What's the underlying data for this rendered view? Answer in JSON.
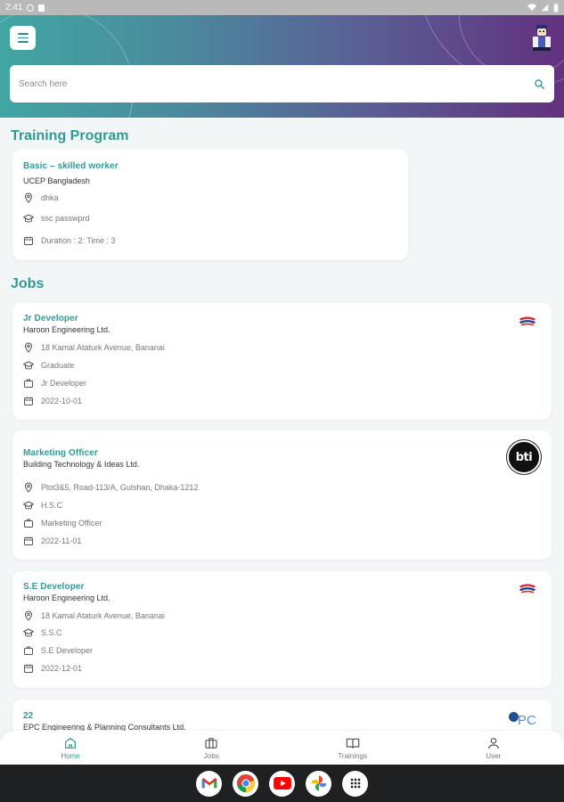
{
  "status_bar": {
    "time": "2:41"
  },
  "header": {
    "search_placeholder": "Search here"
  },
  "training_section": {
    "title": "Training Program",
    "cards": [
      {
        "title": "Basic – skilled worker",
        "organization": "UCEP Bangladesh",
        "location": "dhka",
        "qualification": "ssc passwprd",
        "duration": "Duration : 2: Time : 3"
      }
    ]
  },
  "jobs_section": {
    "title": "Jobs",
    "cards": [
      {
        "title": "Jr Developer",
        "company": "Haroon Engineering Ltd.",
        "address": "18 Kamal Ataturk Avenue, Bananai",
        "education": "Graduate",
        "position": "Jr Developer",
        "date": "2022-10-01",
        "logo": "haroon-logo"
      },
      {
        "title": "Marketing Officer",
        "company": "Building Technology & Ideas Ltd.",
        "address": "Plot3&5, Road-113/A, Gulshan, Dhaka-1212",
        "education": "H.S.C",
        "position": "Marketing Officer",
        "date": "2022-11-01",
        "logo": "bti-logo",
        "logo_text": "bti"
      },
      {
        "title": "S.E Developer",
        "company": "Haroon Engineering Ltd.",
        "address": "18 Kamal Ataturk Avenue, Bananai",
        "education": "S.S.C",
        "position": "S.E Developer",
        "date": "2022-12-01",
        "logo": "haroon-logo"
      },
      {
        "title": "22",
        "company": "EPC Engineering & Planning Consultants Ltd.",
        "logo": "epc-logo",
        "logo_text": "PC"
      }
    ]
  },
  "bottom_nav": {
    "items": [
      {
        "label": "Home",
        "icon": "home-icon",
        "active": true
      },
      {
        "label": "Jobs",
        "icon": "briefcase-icon",
        "active": false
      },
      {
        "label": "Trainings",
        "icon": "book-icon",
        "active": false
      },
      {
        "label": "User",
        "icon": "user-icon",
        "active": false
      }
    ]
  },
  "taskbar": {
    "apps": [
      "gmail-icon",
      "chrome-icon",
      "youtube-icon",
      "photos-icon",
      "app-drawer-icon"
    ]
  },
  "colors": {
    "accent": "#2f9a95",
    "header_start": "#41a6a2",
    "header_end": "#63317f"
  }
}
